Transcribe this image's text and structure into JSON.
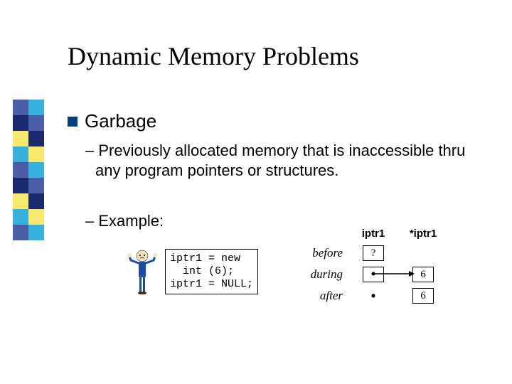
{
  "title": "Dynamic Memory Problems",
  "main_bullet": "Garbage",
  "sub_bullet_1": "– Previously allocated memory that is inaccessible thru any program pointers or structures.",
  "sub_bullet_2": "– Example:",
  "code": {
    "l1": "iptr1 = new",
    "l2": "  int (6);",
    "l3": "iptr1 = NULL;"
  },
  "diagram": {
    "col_iptr": "iptr1",
    "col_deref": "*iptr1",
    "rows": {
      "before": {
        "label": "before",
        "iptr": "?",
        "deref": ""
      },
      "during": {
        "label": "during",
        "iptr": "",
        "deref": "6"
      },
      "after": {
        "label": "after",
        "iptr": "•",
        "deref": "6"
      }
    }
  },
  "sidebar_colors": [
    [
      "#4a5fa8",
      "#38b0de"
    ],
    [
      "#1a2a6c",
      "#4a5fa8"
    ],
    [
      "#f7e96b",
      "#1a2a6c"
    ],
    [
      "#38b0de",
      "#f7e96b"
    ],
    [
      "#4a5fa8",
      "#38b0de"
    ],
    [
      "#1a2a6c",
      "#4a5fa8"
    ],
    [
      "#f7e96b",
      "#1a2a6c"
    ],
    [
      "#38b0de",
      "#f7e96b"
    ],
    [
      "#4a5fa8",
      "#38b0de"
    ]
  ]
}
